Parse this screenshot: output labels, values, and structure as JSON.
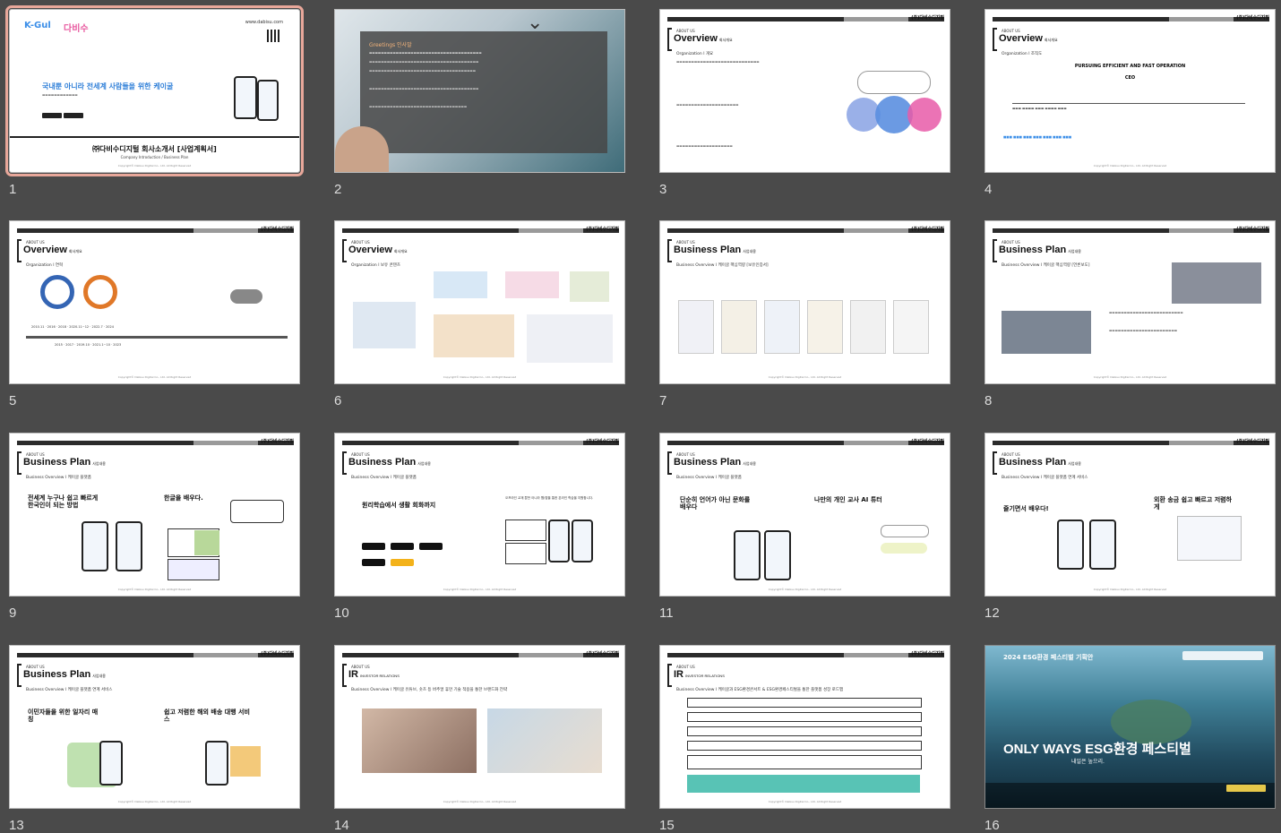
{
  "slides": [
    {
      "num": "1",
      "title": "㈜다비수디지털 회사소개서 [사업계획서]",
      "sub": "Company Introduction / Business Plan",
      "tag": "국내뿐 아니라 전세계 사람들을 위한 케이굴",
      "url": "www.dabisu.com",
      "logo1": "K-Gul",
      "logo2": "다비수"
    },
    {
      "num": "2",
      "title": "Greetings 인사말"
    },
    {
      "num": "3",
      "title": "Overview",
      "small": "회사개요",
      "sub": "Organization l 개요"
    },
    {
      "num": "4",
      "title": "Overview",
      "small": "회사개요",
      "sub": "Organization l 조직도",
      "tag": "PURSUING EFFICIENT AND FAST OPERATION",
      "ceo": "CEO"
    },
    {
      "num": "5",
      "title": "Overview",
      "small": "회사개요",
      "sub": "Organization l 연혁"
    },
    {
      "num": "6",
      "title": "Overview",
      "small": "회사개요",
      "sub": "Organization l 보유 콘텐츠"
    },
    {
      "num": "7",
      "title": "Business Plan",
      "small": "사업내용",
      "sub": "Business Overview l 케이굴 핵심역량 [보유인증서]"
    },
    {
      "num": "8",
      "title": "Business Plan",
      "small": "사업내용",
      "sub": "Business Overview l 케이굴 핵심역량 [언론보도]"
    },
    {
      "num": "9",
      "title": "Business Plan",
      "small": "사업내용",
      "sub": "Business Overview l 케이굴 플랫폼",
      "h1": "전세계 누구나 쉽고 빠르게 한국인이 되는 방법",
      "h2": "한글을 배우다."
    },
    {
      "num": "10",
      "title": "Business Plan",
      "small": "사업내용",
      "sub": "Business Overview l 케이굴 플랫폼",
      "h1": "원리학습에서 생활 회화까지",
      "h2": "오프라인 교재 뿐만 아니라 웹/앱을 통한 온라인 학습을 지원합니다."
    },
    {
      "num": "11",
      "title": "Business Plan",
      "small": "사업내용",
      "sub": "Business Overview l 케이굴 플랫폼",
      "h1": "단순히 언어가 아닌 문화를 배우다",
      "h2": "나만의 개인 교사 AI 튜터"
    },
    {
      "num": "12",
      "title": "Business Plan",
      "small": "사업내용",
      "sub": "Business Overview l 케이굴 플랫폼 연계 서비스",
      "h1": "즐기면서 배우다!",
      "h2": "외환 송금 쉽고 빠르고 저렴하게"
    },
    {
      "num": "13",
      "title": "Business Plan",
      "small": "사업내용",
      "sub": "Business Overview l 케이굴 플랫폼 연계 서비스",
      "h1": "이민자들을 위한 일자리 매칭",
      "h2": "쉽고 저렴한 해외 배송 대행 서비스"
    },
    {
      "num": "14",
      "title": "IR",
      "small": "INVESTOR RELATIONS",
      "sub": "Business Overview l 케이굴 유튜브, 숏츠 등 버추얼 휴먼 기술 적용을 통한 브랜드화 전략"
    },
    {
      "num": "15",
      "title": "IR",
      "small": "INVESTOR RELATIONS",
      "sub": "Business Overview l 케이굴과 ESG환경콘서트 & ESG환경페스티벌을 통한 플랫폼 성장 로드맵"
    },
    {
      "num": "16",
      "title": "ONLY WAYS ESG환경 페스티벌",
      "sub": "2024 ESG환경 페스티벌 기획안",
      "tag": "내일은 높으리."
    }
  ],
  "brand": "(주)다비수디지털",
  "about": "ABOUT US",
  "footer": "Copyright© Dabisu Digital Co., Ltd. All Right Reserved"
}
